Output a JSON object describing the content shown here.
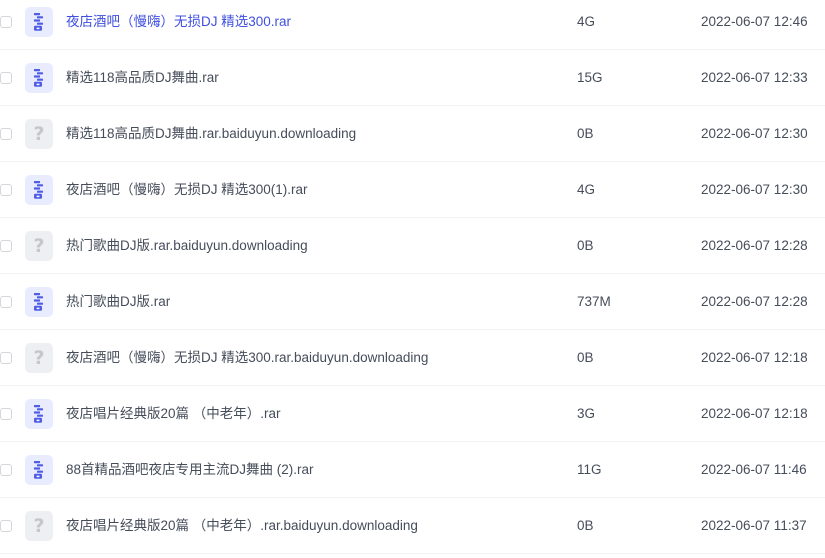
{
  "files": [
    {
      "name": "夜店酒吧（慢嗨）无损DJ 精选300.rar",
      "size": "4G",
      "date": "2022-06-07 12:46",
      "icon": "archive-file-icon",
      "highlighted": true
    },
    {
      "name": "精选118高品质DJ舞曲.rar",
      "size": "15G",
      "date": "2022-06-07 12:33",
      "icon": "archive-file-icon"
    },
    {
      "name": "精选118高品质DJ舞曲.rar.baiduyun.downloading",
      "size": "0B",
      "date": "2022-06-07 12:30",
      "icon": "unknown-file-icon"
    },
    {
      "name": "夜店酒吧（慢嗨）无损DJ 精选300(1).rar",
      "size": "4G",
      "date": "2022-06-07 12:30",
      "icon": "archive-file-icon"
    },
    {
      "name": "热门歌曲DJ版.rar.baiduyun.downloading",
      "size": "0B",
      "date": "2022-06-07 12:28",
      "icon": "unknown-file-icon"
    },
    {
      "name": "热门歌曲DJ版.rar",
      "size": "737M",
      "date": "2022-06-07 12:28",
      "icon": "archive-file-icon"
    },
    {
      "name": "夜店酒吧（慢嗨）无损DJ 精选300.rar.baiduyun.downloading",
      "size": "0B",
      "date": "2022-06-07 12:18",
      "icon": "unknown-file-icon"
    },
    {
      "name": "夜店唱片经典版20篇 （中老年）.rar",
      "size": "3G",
      "date": "2022-06-07 12:18",
      "icon": "archive-file-icon"
    },
    {
      "name": "88首精品酒吧夜店专用主流DJ舞曲 (2).rar",
      "size": "11G",
      "date": "2022-06-07 11:46",
      "icon": "archive-file-icon"
    },
    {
      "name": "夜店唱片经典版20篇 （中老年）.rar.baiduyun.downloading",
      "size": "0B",
      "date": "2022-06-07 11:37",
      "icon": "unknown-file-icon"
    }
  ],
  "colors": {
    "accent": "#3f4fe0",
    "text": "#454d5a",
    "archive_icon_bg": "#e9ebff",
    "archive_icon_fg": "#4f5ce6",
    "unknown_icon_bg": "#eeeff2",
    "unknown_icon_fg": "#c3c6cc",
    "divider": "#f1f2f4"
  }
}
